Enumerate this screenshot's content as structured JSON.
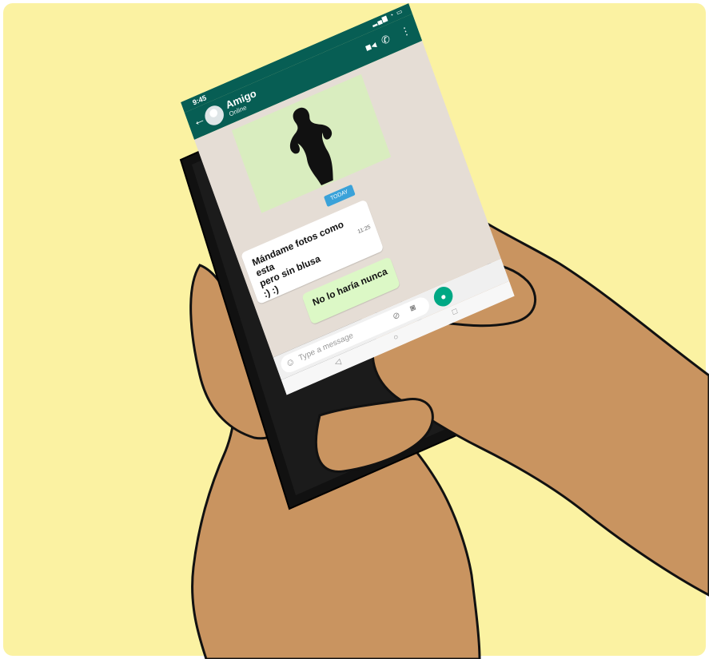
{
  "phone": {
    "status_time": "9:45",
    "contact_name": "Amigo",
    "contact_status": "Online",
    "icons": [
      "back-arrow-icon",
      "avatar-icon",
      "video-call-icon",
      "phone-call-icon",
      "more-menu-icon",
      "emoji-icon",
      "attach-icon",
      "camera-icon",
      "mic-icon"
    ]
  },
  "chat": {
    "date_label": "TODAY",
    "incoming_message": "Mándame fotos como esta\npero sin blusa\n:) :)",
    "incoming_time": "11:25",
    "outgoing_message": "No lo haría nunca"
  },
  "composer": {
    "placeholder": "Type a message"
  },
  "colors": {
    "background": "#fbf2a2",
    "skin": "#c99460",
    "whatsapp_green": "#075e54",
    "outgoing_bubble": "#dcf8c6",
    "chat_bg": "#e5ddd5"
  }
}
